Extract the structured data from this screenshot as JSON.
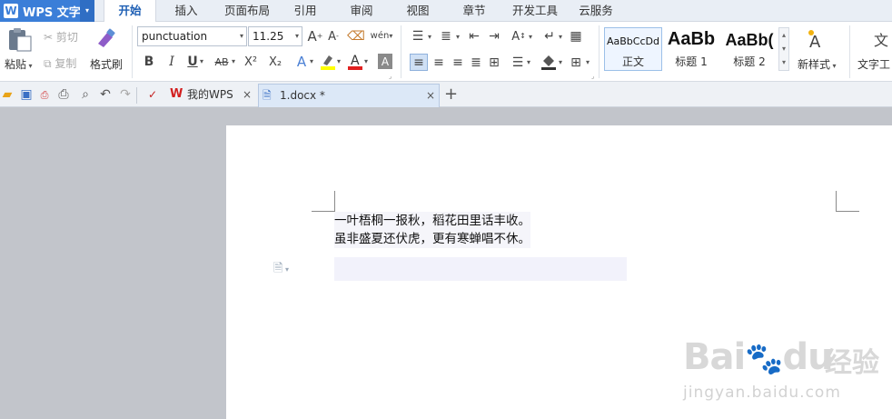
{
  "app": {
    "logo": "W",
    "title": "WPS 文字",
    "dropdown_arrow": "▾"
  },
  "menu_tabs": [
    "开始",
    "插入",
    "页面布局",
    "引用",
    "审阅",
    "视图",
    "章节",
    "开发工具",
    "云服务"
  ],
  "active_tab": "开始",
  "clipboard": {
    "paste": "粘贴",
    "cut": "剪切",
    "copy": "复制",
    "format_painter": "格式刷"
  },
  "font": {
    "name": "punctuation",
    "size": "11.25"
  },
  "format_buttons": {
    "bold": "B",
    "italic": "I",
    "underline": "U",
    "strike": "AB",
    "superscript": "X²",
    "subscript": "X₂"
  },
  "styles": [
    {
      "preview": "AaBbCcDd",
      "label": "正文"
    },
    {
      "preview": "AaBb",
      "label": "标题 1"
    },
    {
      "preview": "AaBb(",
      "label": "标题 2"
    }
  ],
  "new_style": "新样式",
  "text_tools": "文字工",
  "doc_tabs": [
    {
      "label": "我的WPS",
      "close": "×"
    },
    {
      "label": "1.docx *",
      "close": "×"
    }
  ],
  "add_tab": "+",
  "document": {
    "lines": [
      "一叶梧桐一报秋，稻花田里话丰收。",
      "虽非盛夏还伏虎，更有寒蝉唱不休。"
    ]
  },
  "watermark": {
    "brand_left": "Bai",
    "brand_right": "du",
    "brand_cn": "经验",
    "url": "jingyan.baidu.com"
  },
  "colors": {
    "app_blue": "#3b7ed8",
    "active_tab_text": "#1e5fb4",
    "highlight_yellow": "#ffff00",
    "font_red": "#e02020"
  }
}
